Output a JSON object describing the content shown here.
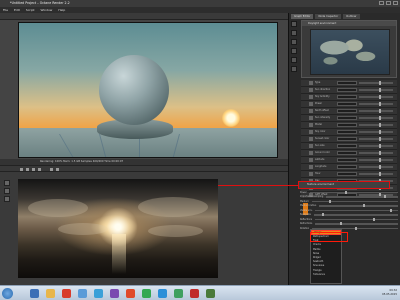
{
  "window": {
    "title": "*Untitled Project – Octane Render 2.2"
  },
  "menu": {
    "items": [
      "File",
      "Edit",
      "Script",
      "Window",
      "Help"
    ]
  },
  "viewport": {
    "status": "Rendering: 100%  Mem: 1.5 GB  Samples 400/400  Time 00:00:07"
  },
  "right_panel": {
    "tabs": [
      "Graph Editor",
      "Node Inspector",
      "Outliner"
    ],
    "node_title": "Daylight environment",
    "hdr_node_label": "Texture environment",
    "param_labels": [
      "Type",
      "Sun direction",
      "Sky turbidity",
      "Power",
      "North offset",
      "Sun intensity",
      "Model",
      "Sky color",
      "Sunset color",
      "Sun size",
      "Ground color",
      "Latitude",
      "Longitude",
      "Hour",
      "Day",
      "Month",
      "GMT offset"
    ],
    "lower_param_labels": [
      "Power",
      "Importance sampling",
      "Medium",
      "Medium radius",
      "Visible env.",
      "Backplate",
      "Reflections",
      "Refractions",
      "Rotation",
      "Gamma"
    ]
  },
  "popup": {
    "selected": "Image",
    "options": [
      "Image",
      "RGB spectrum",
      "Float",
      "Checks",
      "Marble",
      "Noise",
      "Ridged",
      "Sawtooth",
      "Sine wave",
      "Triangle",
      "Turbulence",
      "Clamp",
      "Cosine mix"
    ]
  },
  "taskbar": {
    "time": "09:32",
    "date": "05.05.2015"
  }
}
